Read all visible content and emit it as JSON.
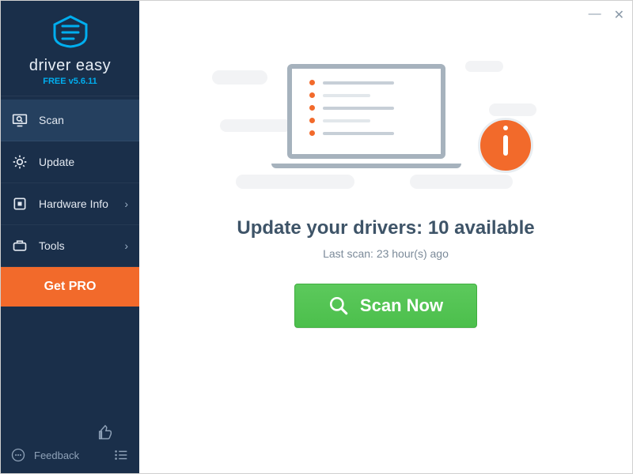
{
  "brand": {
    "name": "driver easy",
    "version_label": "FREE v5.6.11"
  },
  "sidebar": {
    "items": [
      {
        "label": "Scan",
        "name": "scan",
        "has_submenu": false,
        "active": true
      },
      {
        "label": "Update",
        "name": "update",
        "has_submenu": false,
        "active": false
      },
      {
        "label": "Hardware Info",
        "name": "hardware-info",
        "has_submenu": true,
        "active": false
      },
      {
        "label": "Tools",
        "name": "tools",
        "has_submenu": true,
        "active": false
      }
    ],
    "get_pro_label": "Get PRO",
    "feedback_label": "Feedback"
  },
  "main": {
    "headline_prefix": "Update your drivers: ",
    "available_count": 10,
    "headline_suffix": " available",
    "last_scan_label": "Last scan: 23 hour(s) ago",
    "scan_button_label": "Scan Now"
  },
  "colors": {
    "sidebar_bg": "#1a2f4a",
    "accent_orange": "#f26a2b",
    "accent_green": "#4cbf4c",
    "brand_blue": "#00aeef"
  }
}
